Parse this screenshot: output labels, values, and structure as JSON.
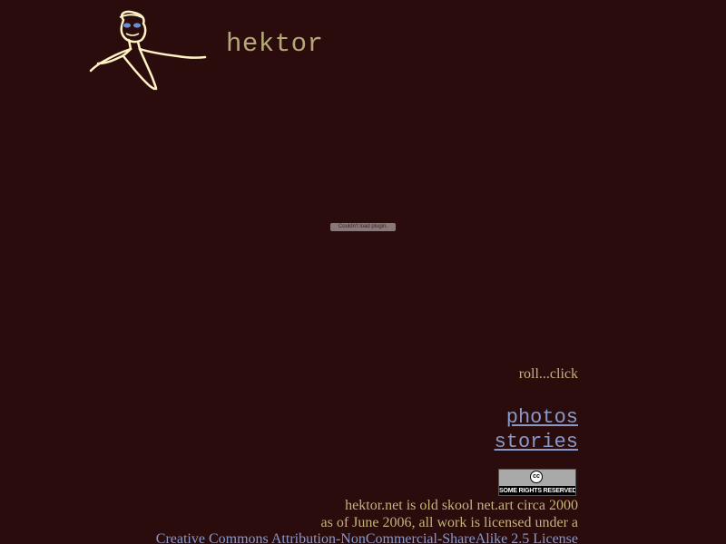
{
  "header": {
    "title": "hektor",
    "logo_icon": "stick-figure-self-portrait-icon"
  },
  "plugin": {
    "message": "Couldn't load plugin."
  },
  "main": {
    "hint": "roll...click",
    "nav": [
      {
        "label": "photos"
      },
      {
        "label": "stories"
      }
    ]
  },
  "license": {
    "badge_symbol": "cc",
    "badge_text": "SOME RIGHTS RESERVED",
    "line1": "hektor.net is old skool net.art circa 2000",
    "line2": "as of June 2006, all work is licensed under a",
    "link_text": "Creative Commons Attribution-NonCommercial-ShareAlike 2.5 License"
  },
  "colors": {
    "background": "#2a0c0c",
    "title": "#b5a878",
    "text": "#c6b27a",
    "link": "#8a98c8",
    "sketch": "#fff3c4"
  }
}
